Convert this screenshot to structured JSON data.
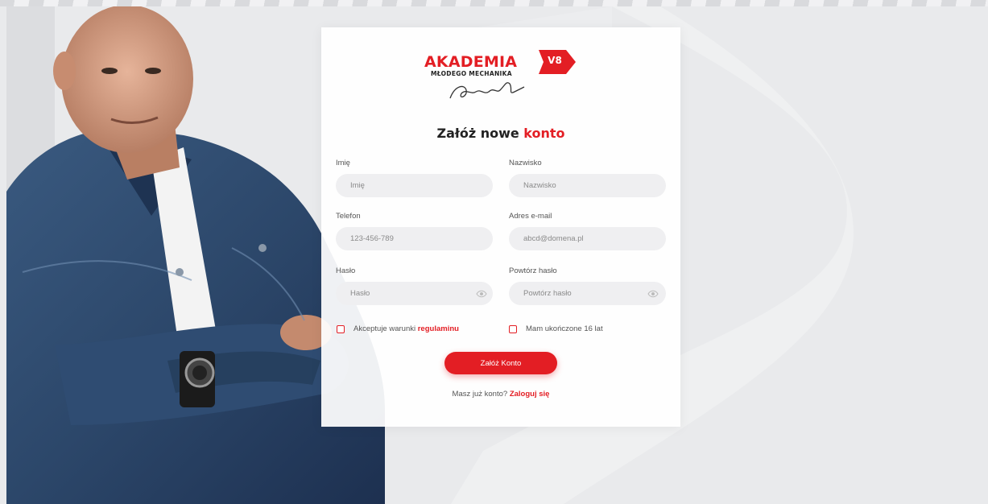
{
  "colors": {
    "accent": "#e31e24",
    "background": "#e9eaec",
    "input_bg": "#efeff1"
  },
  "brand": {
    "title": "AKADEMIA",
    "subtitle": "MŁODEGO MECHANIKA",
    "badge": "V8",
    "signature_icon": "signature-icon"
  },
  "form": {
    "heading_main": "Załóż nowe ",
    "heading_accent": "konto",
    "first_name": {
      "label": "Imię",
      "placeholder": "Imię"
    },
    "last_name": {
      "label": "Nazwisko",
      "placeholder": "Nazwisko"
    },
    "phone": {
      "label": "Telefon",
      "placeholder": "123-456-789"
    },
    "email": {
      "label": "Adres e-mail",
      "placeholder": "abcd@domena.pl"
    },
    "password": {
      "label": "Hasło",
      "placeholder": "Hasło",
      "icon": "eye-icon"
    },
    "password_repeat": {
      "label": "Powtórz hasło",
      "placeholder": "Powtórz hasło",
      "icon": "eye-icon"
    },
    "terms": {
      "text": "Akceptuje warunki ",
      "link": "regulaminu"
    },
    "age": {
      "text": "Mam ukończone 16 lat"
    },
    "submit_label": "Załóż Konto",
    "login_prompt": "Masz już konto? ",
    "login_link": "Zaloguj się"
  }
}
